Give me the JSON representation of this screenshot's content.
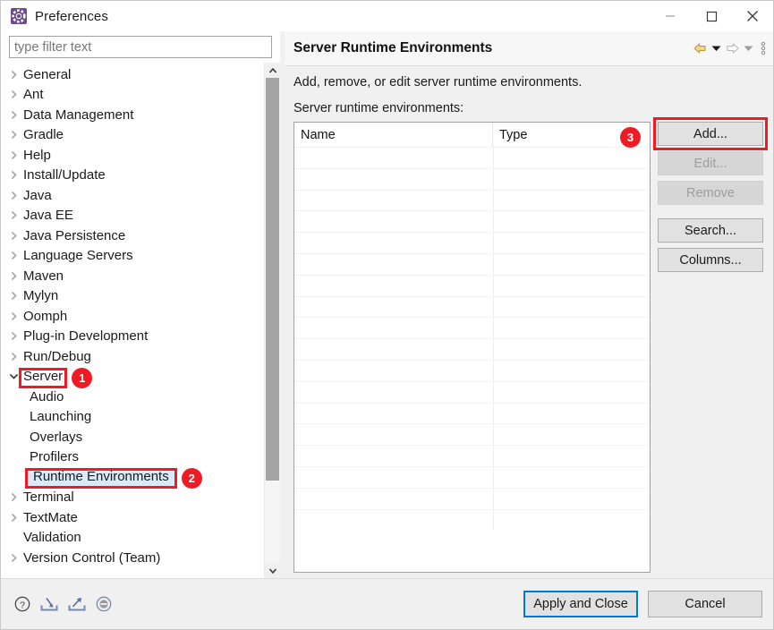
{
  "window": {
    "title": "Preferences",
    "icon": "preferences-gear-icon",
    "minimize_label": "Minimize",
    "maximize_label": "Maximize",
    "close_label": "Close"
  },
  "sidebar": {
    "filter": {
      "value": "",
      "placeholder": "type filter text"
    },
    "items": [
      {
        "label": "General",
        "expandable": true,
        "expanded": false,
        "child": false
      },
      {
        "label": "Ant",
        "expandable": true,
        "expanded": false,
        "child": false
      },
      {
        "label": "Data Management",
        "expandable": true,
        "expanded": false,
        "child": false
      },
      {
        "label": "Gradle",
        "expandable": true,
        "expanded": false,
        "child": false
      },
      {
        "label": "Help",
        "expandable": true,
        "expanded": false,
        "child": false
      },
      {
        "label": "Install/Update",
        "expandable": true,
        "expanded": false,
        "child": false
      },
      {
        "label": "Java",
        "expandable": true,
        "expanded": false,
        "child": false
      },
      {
        "label": "Java EE",
        "expandable": true,
        "expanded": false,
        "child": false
      },
      {
        "label": "Java Persistence",
        "expandable": true,
        "expanded": false,
        "child": false
      },
      {
        "label": "Language Servers",
        "expandable": true,
        "expanded": false,
        "child": false
      },
      {
        "label": "Maven",
        "expandable": true,
        "expanded": false,
        "child": false
      },
      {
        "label": "Mylyn",
        "expandable": true,
        "expanded": false,
        "child": false
      },
      {
        "label": "Oomph",
        "expandable": true,
        "expanded": false,
        "child": false
      },
      {
        "label": "Plug-in Development",
        "expandable": true,
        "expanded": false,
        "child": false
      },
      {
        "label": "Run/Debug",
        "expandable": true,
        "expanded": false,
        "child": false
      },
      {
        "label": "Server",
        "expandable": true,
        "expanded": true,
        "child": false,
        "annotated": true,
        "badge": "1"
      },
      {
        "label": "Audio",
        "expandable": false,
        "expanded": false,
        "child": true
      },
      {
        "label": "Launching",
        "expandable": false,
        "expanded": false,
        "child": true
      },
      {
        "label": "Overlays",
        "expandable": false,
        "expanded": false,
        "child": true
      },
      {
        "label": "Profilers",
        "expandable": false,
        "expanded": false,
        "child": true
      },
      {
        "label": "Runtime Environments",
        "expandable": false,
        "expanded": false,
        "child": true,
        "selected": true,
        "annotated": true,
        "badge": "2"
      },
      {
        "label": "Terminal",
        "expandable": true,
        "expanded": false,
        "child": false
      },
      {
        "label": "TextMate",
        "expandable": true,
        "expanded": false,
        "child": false
      },
      {
        "label": "Validation",
        "expandable": false,
        "expanded": false,
        "child": false
      },
      {
        "label": "Version Control (Team)",
        "expandable": true,
        "expanded": false,
        "child": false
      }
    ],
    "scrollbar": {
      "up_label": "Scroll up",
      "down_label": "Scroll down"
    }
  },
  "page": {
    "title": "Server Runtime Environments",
    "description": "Add, remove, or edit server runtime environments.",
    "group_label": "Server runtime environments:",
    "nav": {
      "back_label": "Back",
      "back_menu_label": "Back history",
      "forward_label": "Forward",
      "forward_menu_label": "Forward history",
      "menu_label": "View menu"
    },
    "table": {
      "columns": [
        "Name",
        "Type"
      ],
      "rows": [],
      "empty_row_count": 18
    },
    "buttons": [
      {
        "label": "Add...",
        "enabled": true,
        "annotated": true,
        "badge": "3"
      },
      {
        "label": "Edit...",
        "enabled": false
      },
      {
        "label": "Remove",
        "enabled": false
      },
      {
        "label": "Search...",
        "enabled": true,
        "spaced": true
      },
      {
        "label": "Columns...",
        "enabled": true
      }
    ]
  },
  "footer": {
    "icons": [
      {
        "name": "help-icon",
        "label": "Help"
      },
      {
        "name": "import-icon",
        "label": "Import preferences"
      },
      {
        "name": "export-icon",
        "label": "Export preferences"
      },
      {
        "name": "restore-defaults-icon",
        "label": "Restore defaults"
      }
    ],
    "apply_label": "Apply and Close",
    "cancel_label": "Cancel"
  },
  "colors": {
    "annotation_red": "#ee1b24",
    "selection_blue": "#d9ebfa",
    "default_button_focus": "#0078d7",
    "back_arrow_gold": "#e8b33c"
  }
}
